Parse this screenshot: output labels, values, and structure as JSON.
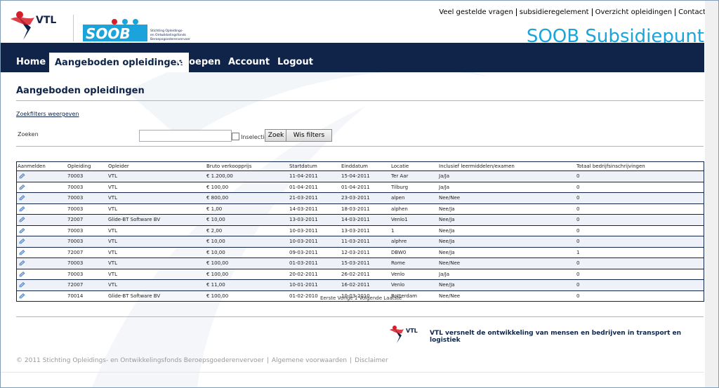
{
  "header": {
    "top_links": [
      "Veel gestelde vragen",
      "subsidieregelement",
      "Overzicht opleidingen",
      "Contact"
    ],
    "site_title": "SOOB Subsidiepunt",
    "logo_vtl": "VTL",
    "logo_soob": "SOOB",
    "logo_soob_sub": "Stichting Opleidings- en Ontwikkelingsfonds Beroepsgoederenvervoer"
  },
  "nav": {
    "items": [
      "Home",
      "Aangeboden opleidingen",
      "Groepen",
      "Account",
      "Logout"
    ],
    "active_index": 1
  },
  "page": {
    "title": "Aangeboden opleidingen",
    "filters_link": "Zoekfilters weergeven"
  },
  "search": {
    "label": "Zoeken",
    "value": "",
    "checkbox_label": "Inselectie",
    "zoek_button": "Zoek",
    "clear_button": "Wis filters"
  },
  "table": {
    "headers": [
      "Aanmelden",
      "Opleiding",
      "Opleider",
      "Bruto verkoopprijs",
      "Startdatum",
      "Einddatum",
      "Locatie",
      "Inclusief leermiddelen/examen",
      "Totaal bedrijfsinschrijvingen"
    ],
    "rows": [
      [
        "70003",
        "VTL",
        "€ 1.200,00",
        "11-04-2011",
        "15-04-2011",
        "Ter Aar",
        "Ja/Ja",
        "0"
      ],
      [
        "70003",
        "VTL",
        "€ 100,00",
        "01-04-2011",
        "01-04-2011",
        "Tilburg",
        "Ja/Ja",
        "0"
      ],
      [
        "70003",
        "VTL",
        "€ 800,00",
        "21-03-2011",
        "23-03-2011",
        "alpen",
        "Nee/Nee",
        "0"
      ],
      [
        "70003",
        "VTL",
        "€ 1,00",
        "14-03-2011",
        "18-03-2011",
        "alphen",
        "Nee/Ja",
        "0"
      ],
      [
        "72007",
        "Glide-BT Software BV",
        "€ 10,00",
        "13-03-2011",
        "14-03-2011",
        "Venlo1",
        "Nee/Ja",
        "0"
      ],
      [
        "70003",
        "VTL",
        "€ 2,00",
        "10-03-2011",
        "13-03-2011",
        "1",
        "Nee/Ja",
        "0"
      ],
      [
        "70003",
        "VTL",
        "€ 10,00",
        "10-03-2011",
        "11-03-2011",
        "alphre",
        "Nee/Ja",
        "0"
      ],
      [
        "72007",
        "VTL",
        "€ 10,00",
        "09-03-2011",
        "12-03-2011",
        "DBW0",
        "Nee/Ja",
        "1"
      ],
      [
        "70003",
        "VTL",
        "€ 100,00",
        "01-03-2011",
        "15-03-2011",
        "Rome",
        "Nee/Nee",
        "0"
      ],
      [
        "70003",
        "VTL",
        "€ 100,00",
        "20-02-2011",
        "26-02-2011",
        "Venlo",
        "Ja/Ja",
        "0"
      ],
      [
        "72007",
        "VTL",
        "€ 11,00",
        "10-01-2011",
        "16-02-2011",
        "Venlo",
        "Nee/Ja",
        "0"
      ],
      [
        "70014",
        "Glide-BT Software BV",
        "€ 100,00",
        "01-02-2010",
        "10-03-2010",
        "Rotterdam",
        "Nee/Nee",
        "0"
      ]
    ]
  },
  "pager": {
    "first": "Eerste",
    "prev": "Vorige",
    "current": "1",
    "next": "Volgende",
    "last": "Laatste"
  },
  "footer": {
    "tagline": "VTL versnelt de ontwikkeling van mensen en bedrijven in transport en logistiek",
    "copyright": "© 2011 Stichting Opleidings- en Ontwikkelingsfonds Beroepsgoederenvervoer",
    "links": [
      "Algemene voorwaarden",
      "Disclaimer"
    ]
  },
  "colors": {
    "nav_bg": "#0f2448",
    "accent": "#1ba4dc",
    "vtl_red": "#d81e2a"
  }
}
